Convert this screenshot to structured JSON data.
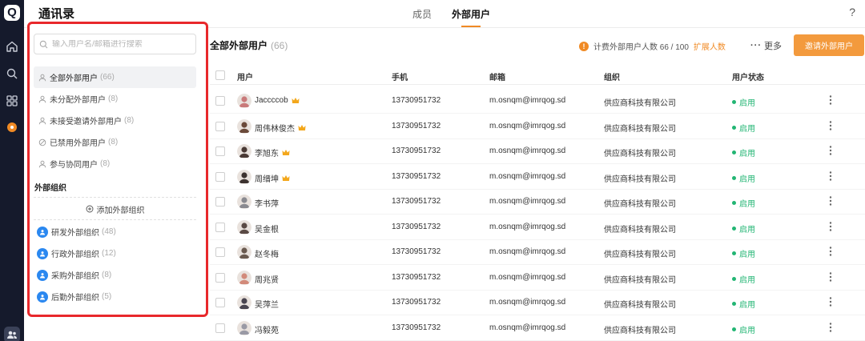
{
  "app": {
    "logo": "Q",
    "title": "通讯录",
    "help": "?"
  },
  "nav_icons": [
    "home-icon",
    "search-icon",
    "apps-icon",
    "notification-icon",
    "contacts-icon"
  ],
  "tabs": [
    {
      "label": "成员",
      "active": false
    },
    {
      "label": "外部用户",
      "active": true
    }
  ],
  "accent_color": "#f08a24",
  "sidebar": {
    "search_placeholder": "输入用户名/邮箱进行搜索",
    "items": [
      {
        "label": "全部外部用户",
        "count": "(66)",
        "active": true,
        "icon": "user-icon"
      },
      {
        "label": "未分配外部用户",
        "count": "(8)",
        "active": false,
        "icon": "user-icon"
      },
      {
        "label": "未接受邀请外部用户",
        "count": "(8)",
        "active": false,
        "icon": "user-icon"
      },
      {
        "label": "已禁用外部用户",
        "count": "(8)",
        "active": false,
        "icon": "ban-icon"
      },
      {
        "label": "参与协同用户",
        "count": "(8)",
        "active": false,
        "icon": "user-icon"
      }
    ],
    "org_section_label": "外部组织",
    "add_org_label": "添加外部组织",
    "orgs": [
      {
        "label": "研发外部组织",
        "count": "(48)"
      },
      {
        "label": "行政外部组织",
        "count": "(12)"
      },
      {
        "label": "采购外部组织",
        "count": "(8)"
      },
      {
        "label": "后勤外部组织",
        "count": "(5)"
      }
    ]
  },
  "main": {
    "title": "全部外部用户",
    "count": "(66)",
    "quota_label": "计费外部用户人数 66 / 100",
    "expand_label": "扩展人数",
    "more_label": "更多",
    "invite_button": "邀请外部用户",
    "columns": {
      "user": "用户",
      "phone": "手机",
      "email": "邮箱",
      "org": "组织",
      "status": "用户状态"
    },
    "rows": [
      {
        "name": "Jaccccob",
        "crown": true,
        "phone": "13730951732",
        "email": "m.osnqm@imrqog.sd",
        "org": "供应商科技有限公司",
        "status": "启用",
        "avatar_color": "#c97a7a"
      },
      {
        "name": "周伟林俊杰",
        "crown": true,
        "phone": "13730951732",
        "email": "m.osnqm@imrqog.sd",
        "org": "供应商科技有限公司",
        "status": "启用",
        "avatar_color": "#6b4a3a"
      },
      {
        "name": "李旭东",
        "crown": true,
        "phone": "13730951732",
        "email": "m.osnqm@imrqog.sd",
        "org": "供应商科技有限公司",
        "status": "启用",
        "avatar_color": "#4a3a35"
      },
      {
        "name": "周缙坤",
        "crown": true,
        "phone": "13730951732",
        "email": "m.osnqm@imrqog.sd",
        "org": "供应商科技有限公司",
        "status": "启用",
        "avatar_color": "#3d3330"
      },
      {
        "name": "李书萍",
        "crown": false,
        "phone": "13730951732",
        "email": "m.osnqm@imrqog.sd",
        "org": "供应商科技有限公司",
        "status": "启用",
        "avatar_color": "#8a8a90"
      },
      {
        "name": "吴金根",
        "crown": false,
        "phone": "13730951732",
        "email": "m.osnqm@imrqog.sd",
        "org": "供应商科技有限公司",
        "status": "启用",
        "avatar_color": "#5a4a45"
      },
      {
        "name": "赵冬梅",
        "crown": false,
        "phone": "13730951732",
        "email": "m.osnqm@imrqog.sd",
        "org": "供应商科技有限公司",
        "status": "启用",
        "avatar_color": "#6a5a50"
      },
      {
        "name": "周兆贤",
        "crown": false,
        "phone": "13730951732",
        "email": "m.osnqm@imrqog.sd",
        "org": "供应商科技有限公司",
        "status": "启用",
        "avatar_color": "#d28a7a"
      },
      {
        "name": "吴萍兰",
        "crown": false,
        "phone": "13730951732",
        "email": "m.osnqm@imrqog.sd",
        "org": "供应商科技有限公司",
        "status": "启用",
        "avatar_color": "#4a4550"
      },
      {
        "name": "冯毅苑",
        "crown": false,
        "phone": "13730951732",
        "email": "m.osnqm@imrqog.sd",
        "org": "供应商科技有限公司",
        "status": "启用",
        "avatar_color": "#9a9aa5"
      }
    ]
  }
}
